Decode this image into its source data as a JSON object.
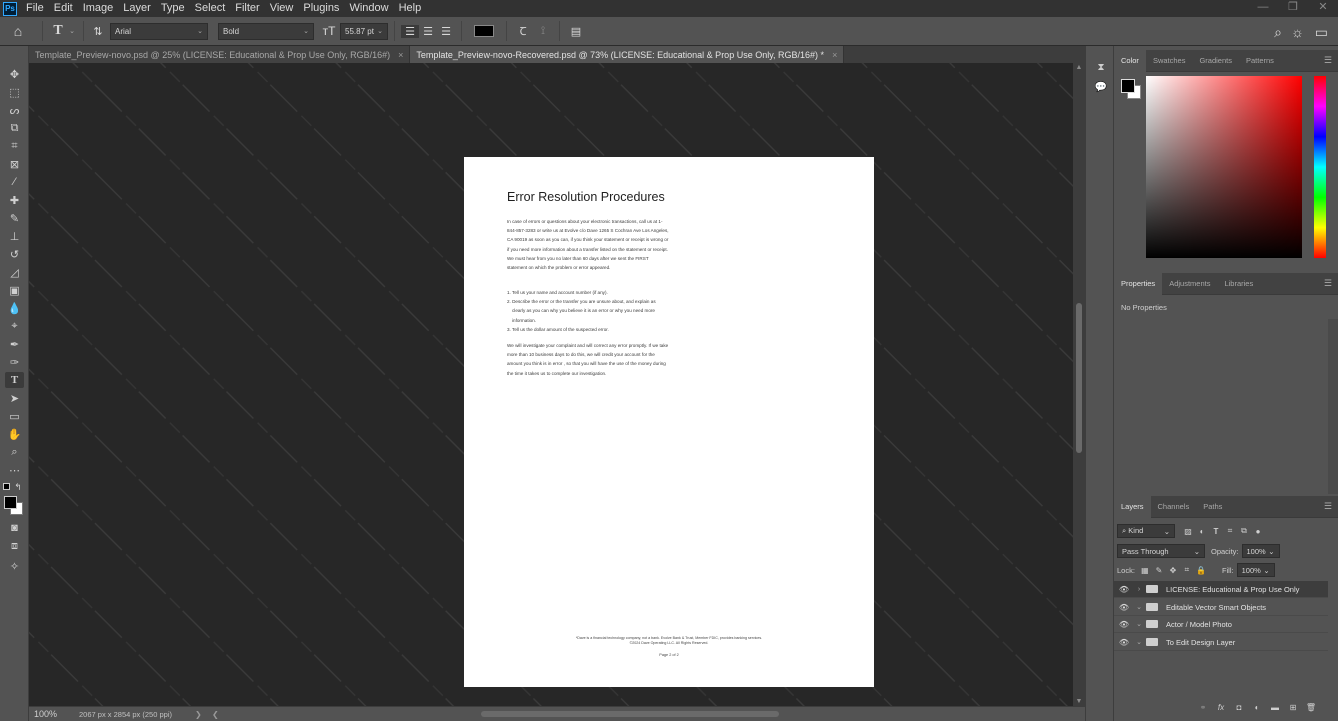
{
  "app": {
    "logo": "Ps"
  },
  "menu": [
    "File",
    "Edit",
    "Image",
    "Layer",
    "Type",
    "Select",
    "Filter",
    "View",
    "Plugins",
    "Window",
    "Help"
  ],
  "window_controls": [
    "—",
    "❐",
    "✕"
  ],
  "options": {
    "font_family": "Arial",
    "font_style": "Bold",
    "font_size": "55.87 pt",
    "text_color": "#000000"
  },
  "tabs": [
    {
      "label": "Template_Preview-novo.psd @ 25% (LICENSE: Educational & Prop Use Only, RGB/16#)",
      "close": "×"
    },
    {
      "label": "Template_Preview-novo-Recovered.psd @ 73% (LICENSE: Educational & Prop Use Only, RGB/16#) *",
      "close": "×"
    }
  ],
  "document": {
    "title": "Error Resolution Procedures",
    "para1": "In case of errors or questions about your electronic transactions, call us at 1-844-857-3283 or write us at Evolve c/o Dave 1265 S Cochran Ave Los Angeles, CA 90019 as soon as you can, if you think your statement or receipt is wrong or if you need more information about a transfer listed on the statement or receipt. We must hear from you no later than 60 days after we sent the FIRST statement on which the problem or error appeared.",
    "list": [
      "1. Tell us your name and account number (if any).",
      "2. Describe the error or the transfer you are unsure about, and explain as clearly as you can why you believe it is an error or why you need more information.",
      "3. Tell us the dollar amount of the suspected error."
    ],
    "para2": "We will investigate your complaint and will correct any error promptly. If we take more than 10 business days to do this, we will credit your account for the amount you think is in error , so that you will have the use of the money during the time it takes us to complete our investigation.",
    "footer_line1": "*Dave is a financial technology company, not a bank. Evolve Bank & Trust, Member FDIC, provides banking services.",
    "footer_line2": "©2024 Dave Operating LLC. All Rights Reserved.",
    "page": "Page 2 of 2"
  },
  "status": {
    "zoom": "100%",
    "doc_info": "2067 px x 2854 px (250 ppi)",
    "arrow_right": "❯",
    "arrow_left": "❮"
  },
  "color_panel": {
    "tabs": [
      "Color",
      "Swatches",
      "Gradients",
      "Patterns"
    ],
    "foreground": "#000000",
    "background": "#ffffff"
  },
  "properties_panel": {
    "tabs": [
      "Properties",
      "Adjustments",
      "Libraries"
    ],
    "empty_text": "No Properties"
  },
  "layers_panel": {
    "tabs": [
      "Layers",
      "Channels",
      "Paths"
    ],
    "filter_kind": "Kind",
    "blend_mode": "Pass Through",
    "opacity_label": "Opacity:",
    "opacity": "100%",
    "lock_label": "Lock:",
    "fill_label": "Fill:",
    "fill": "100%",
    "layers": [
      {
        "name": "LICENSE: Educational & Prop Use Only",
        "selected": true
      },
      {
        "name": "Editable Vector Smart Objects",
        "selected": false
      },
      {
        "name": "Actor / Model Photo",
        "selected": false
      },
      {
        "name": "To Edit Design Layer",
        "selected": false
      }
    ],
    "footer_icons": [
      "link",
      "fx",
      "mask",
      "adjustment",
      "group",
      "new",
      "delete"
    ]
  }
}
